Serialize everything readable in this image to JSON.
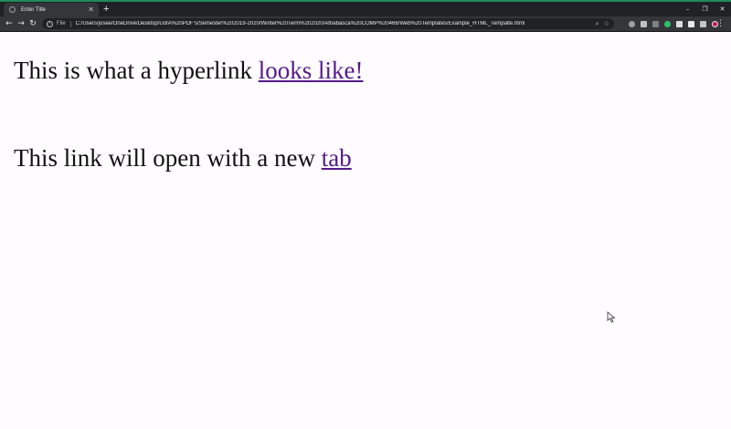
{
  "browser": {
    "tab_title": "Enter Title",
    "new_tab_symbol": "+",
    "url_scheme": "File",
    "url": "C:/Users/josee/OneDrive/Desktop/UofA%20PDF's/Semester%202019-2020/Winter%20Term%202020/Athabasca%20COMP%20466/Web%20Templates/Example_HTML_Tempalte.html",
    "accent_color": "#1f8a5c",
    "icons": {
      "back": "back-arrow-icon",
      "forward": "forward-arrow-icon",
      "reload": "reload-icon",
      "info": "info-icon",
      "zoom": "zoom-icon",
      "bookmark": "star-icon",
      "menu": "kebab-menu-icon"
    }
  },
  "page": {
    "line1_text": "This is what a hyperlink ",
    "line1_link": "looks like!",
    "line2_text": "This link will open with a new ",
    "line2_link": "tab",
    "link_color": "#551a8b"
  }
}
